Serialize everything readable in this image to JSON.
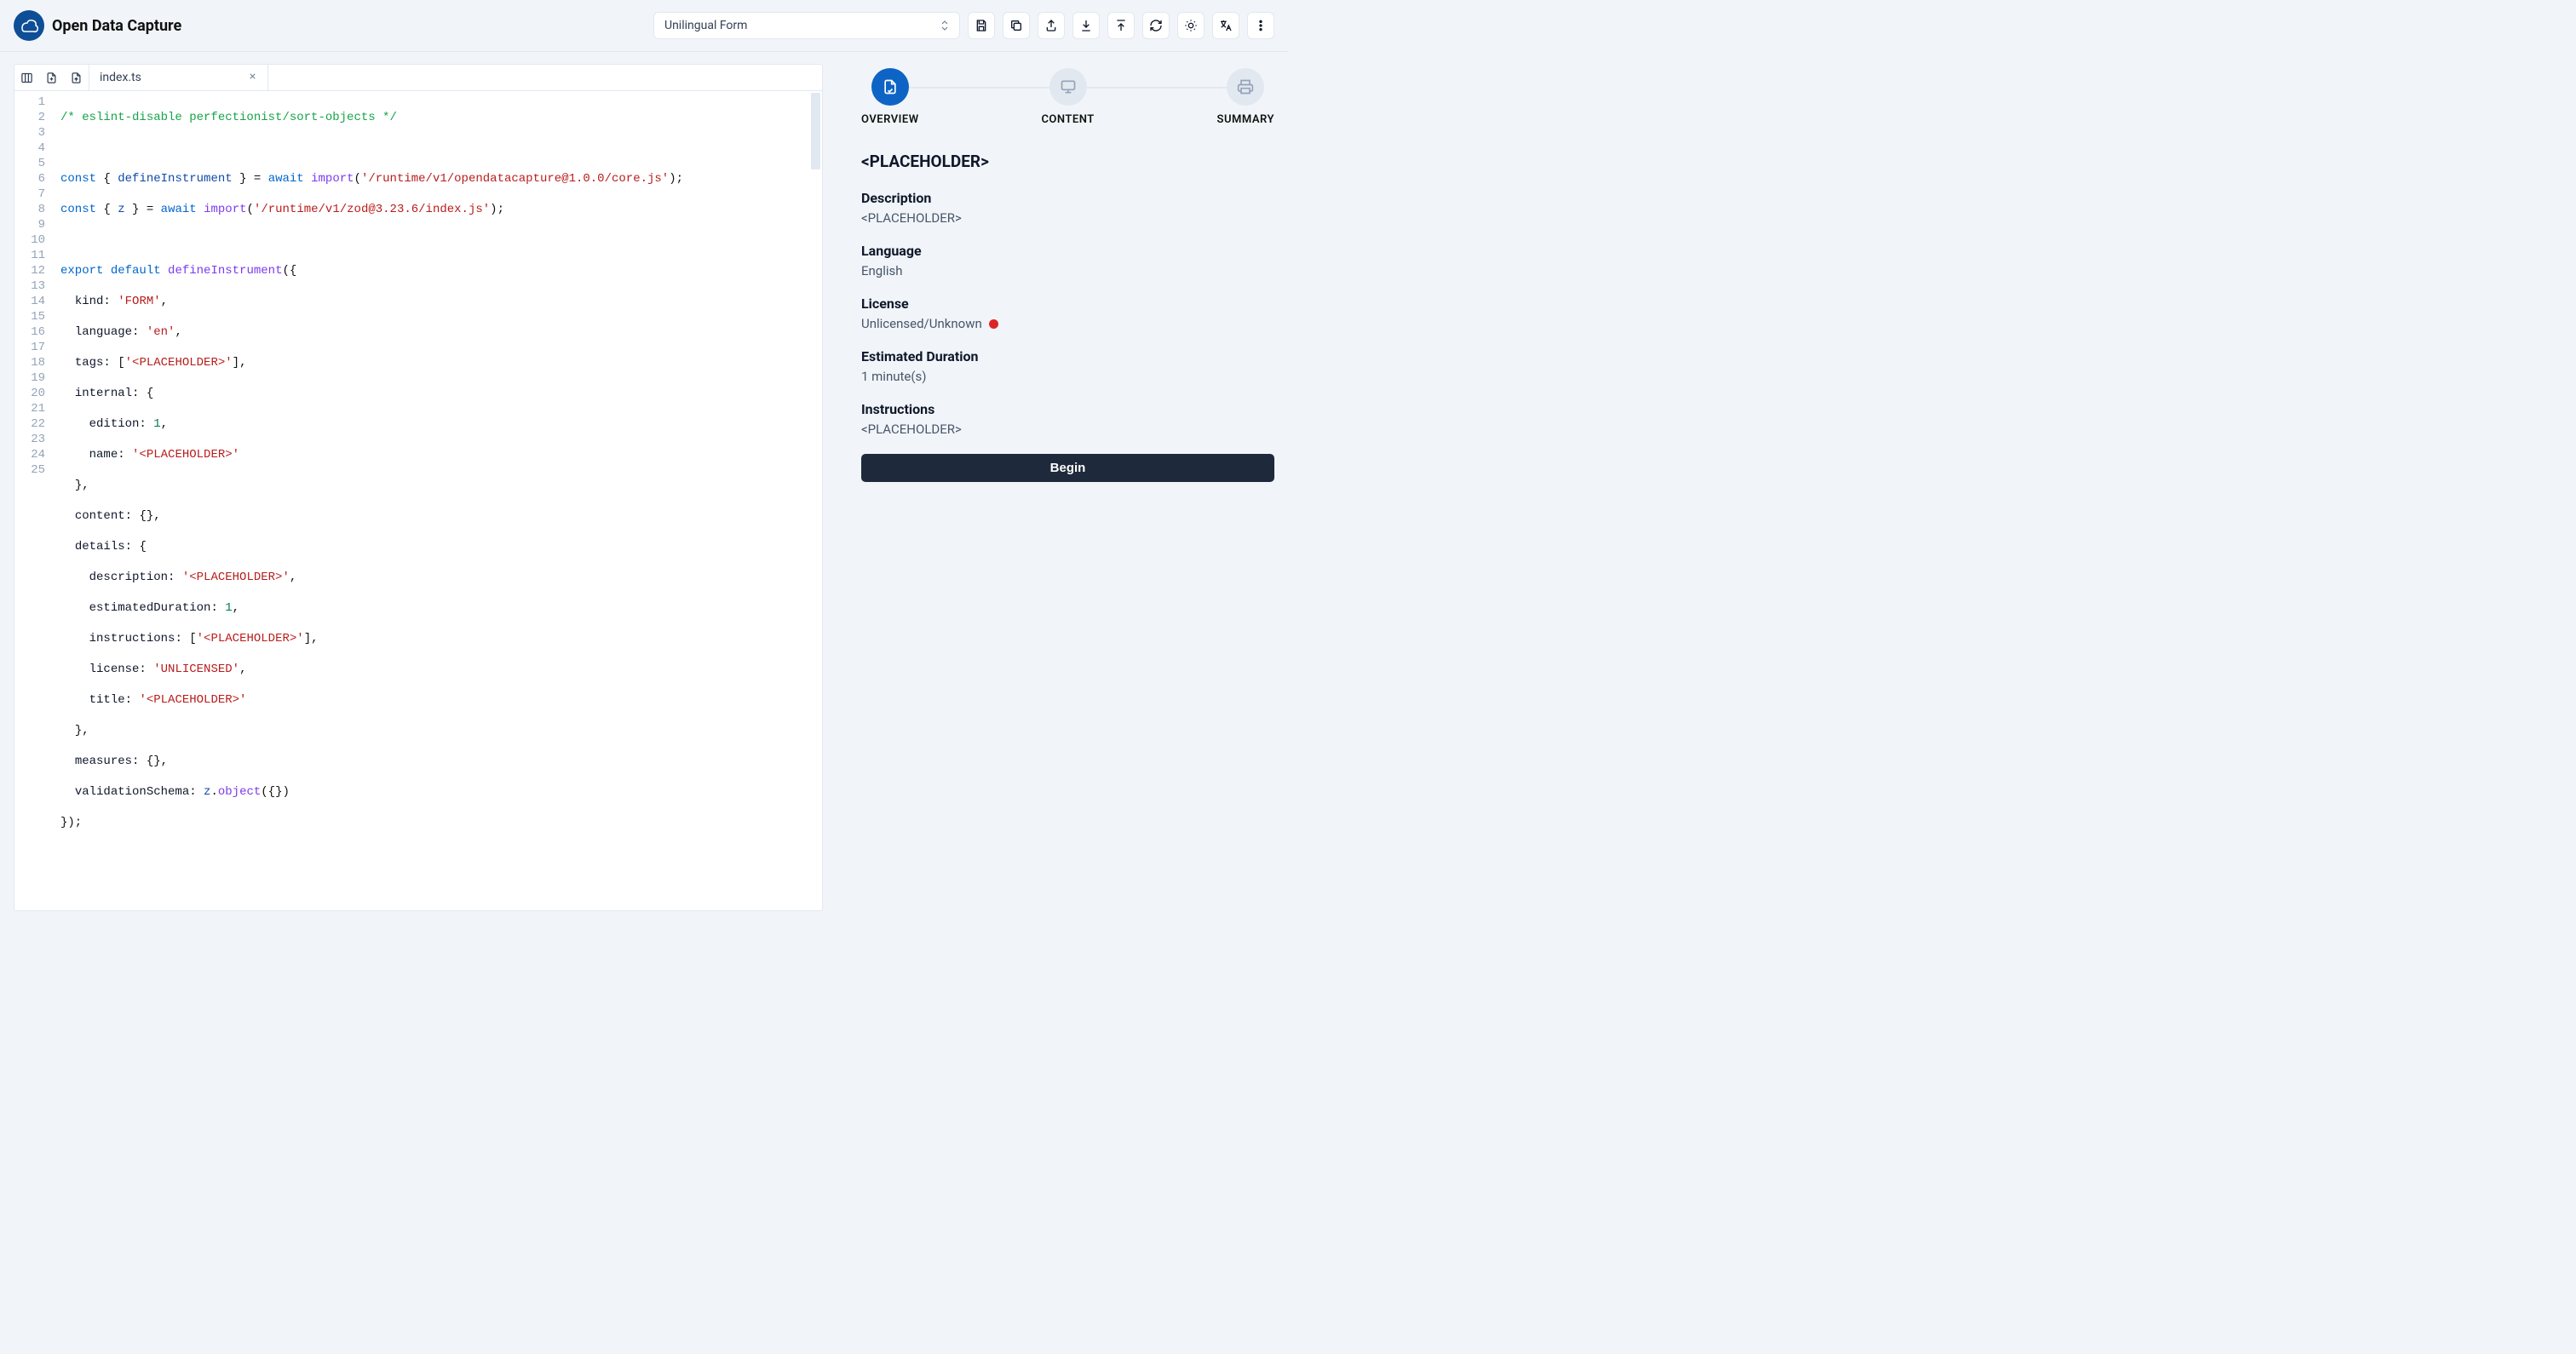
{
  "header": {
    "title": "Open Data Capture",
    "type_select": "Unilingual Form"
  },
  "editor": {
    "tab": "index.ts",
    "lines": 25
  },
  "code": {
    "l1_comment": "/* eslint-disable perfectionist/sort-objects */",
    "l3_import_path": "'/runtime/v1/opendatacapture@1.0.0/core.js'",
    "l4_import_path": "'/runtime/v1/zod@3.23.6/index.js'",
    "l7_kind": "'FORM'",
    "l8_lang": "'en'",
    "l9_tag": "'<PLACEHOLDER>'",
    "l11_edition": "1",
    "l12_name": "'<PLACEHOLDER>'",
    "l16_desc": "'<PLACEHOLDER>'",
    "l17_dur": "1",
    "l18_instr": "'<PLACEHOLDER>'",
    "l19_lic": "'UNLICENSED'",
    "l20_title": "'<PLACEHOLDER>'"
  },
  "steps": {
    "s1": "OVERVIEW",
    "s2": "CONTENT",
    "s3": "SUMMARY"
  },
  "panel": {
    "title": "<PLACEHOLDER>",
    "desc_label": "Description",
    "desc_value": "<PLACEHOLDER>",
    "lang_label": "Language",
    "lang_value": "English",
    "lic_label": "License",
    "lic_value": "Unlicensed/Unknown",
    "dur_label": "Estimated Duration",
    "dur_value": "1 minute(s)",
    "instr_label": "Instructions",
    "instr_value": "<PLACEHOLDER>",
    "begin": "Begin"
  }
}
